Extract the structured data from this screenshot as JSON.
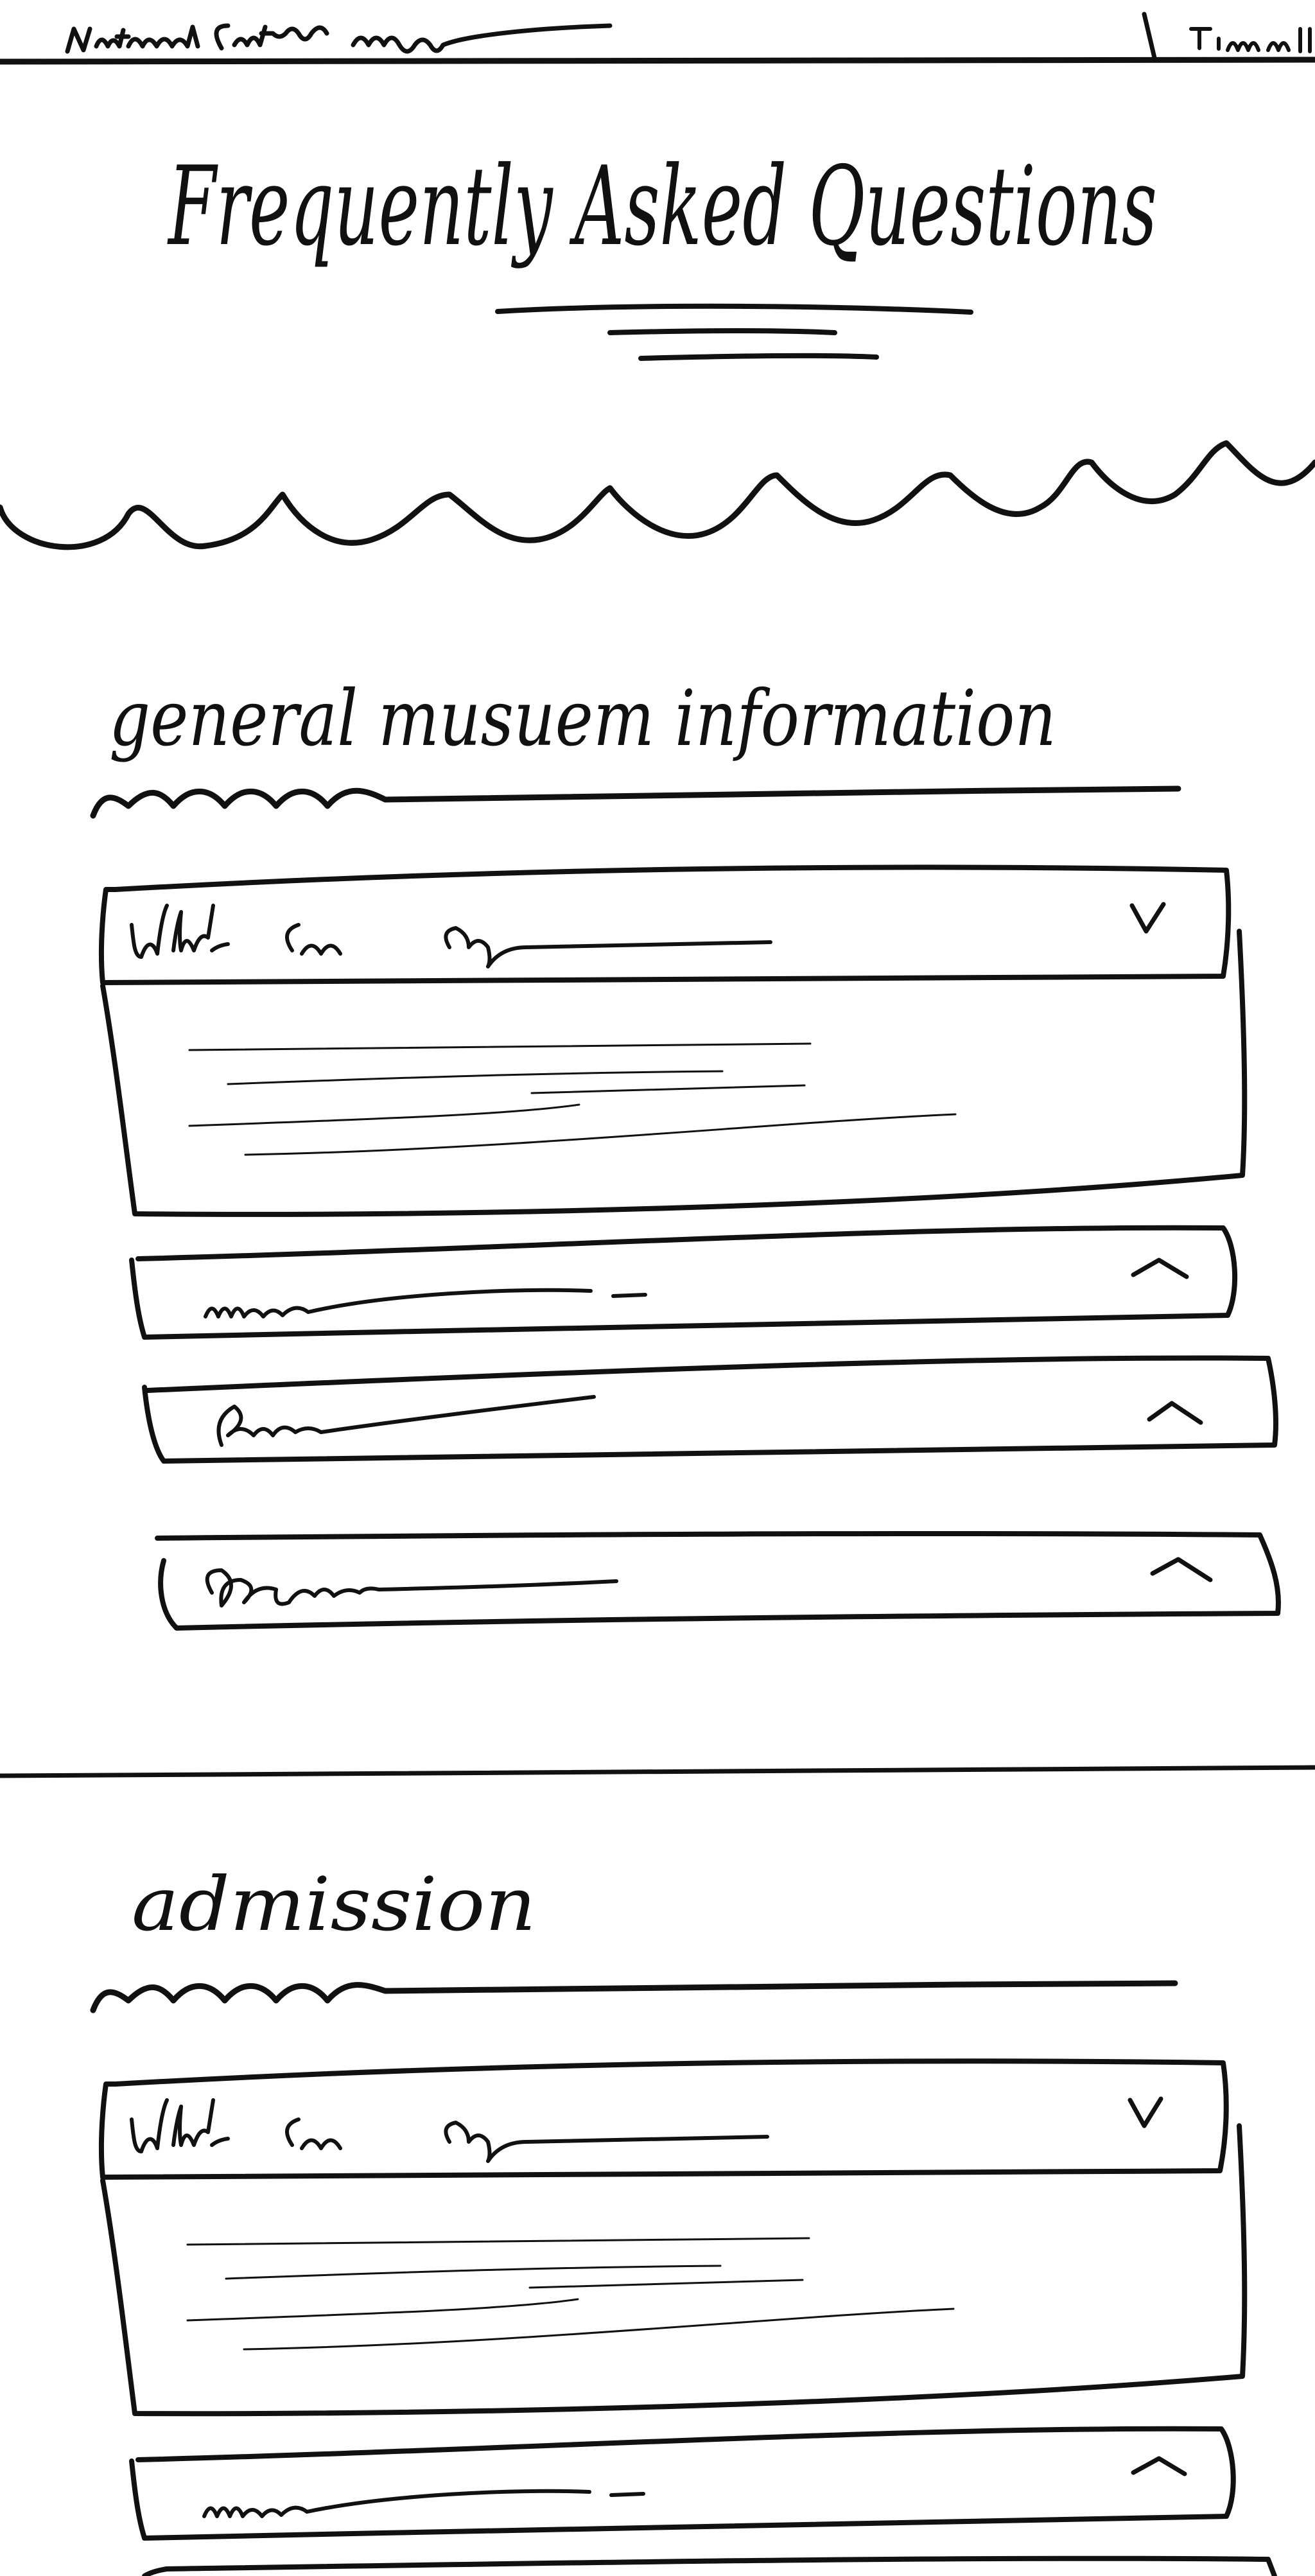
{
  "page": {
    "title": "Frequently Asked Questions"
  },
  "sections": [
    {
      "heading": "general musuem information"
    },
    {
      "heading": "admission"
    }
  ]
}
